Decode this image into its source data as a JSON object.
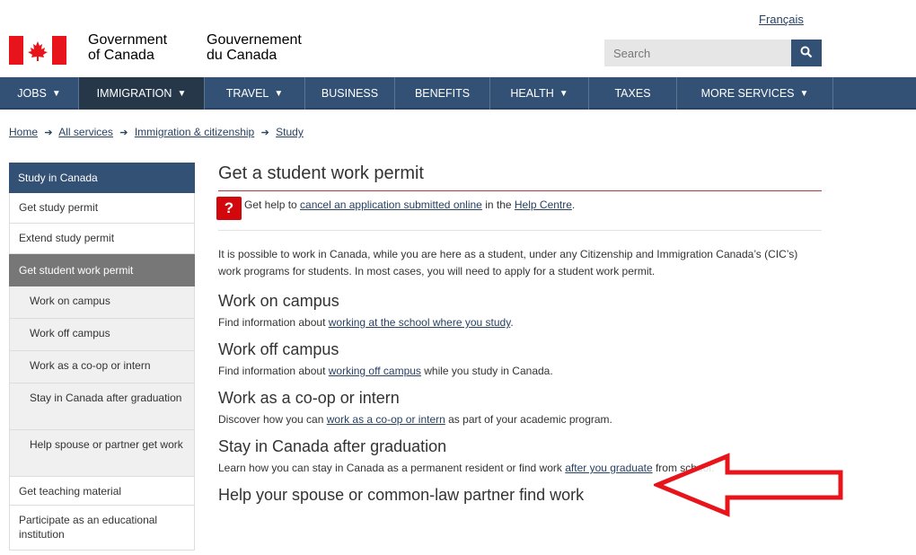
{
  "header": {
    "language_link": "Français",
    "fip_en_line1": "Government",
    "fip_en_line2": "of Canada",
    "fip_fr_line1": "Gouvernement",
    "fip_fr_line2": "du Canada",
    "search_placeholder": "Search",
    "flag_icon": "canada-flag-icon",
    "search_icon": "magnifier-icon"
  },
  "menu": [
    {
      "label": "JOBS",
      "caret": true
    },
    {
      "label": "IMMIGRATION",
      "caret": true
    },
    {
      "label": "TRAVEL",
      "caret": true
    },
    {
      "label": "BUSINESS",
      "caret": false
    },
    {
      "label": "BENEFITS",
      "caret": false
    },
    {
      "label": "HEALTH",
      "caret": true
    },
    {
      "label": "TAXES",
      "caret": false
    },
    {
      "label": "MORE SERVICES",
      "caret": true
    }
  ],
  "breadcrumb": [
    "Home",
    "All services",
    "Immigration & citizenship",
    "Study"
  ],
  "sidenav": [
    "Study in Canada",
    "Get study permit",
    "Extend study permit",
    "Get student work permit",
    "Work on campus",
    "Work off campus",
    "Work as a co-op or intern",
    "Stay in Canada after graduation",
    "Help spouse or partner get work",
    "Get teaching material",
    "Participate as an educational institution"
  ],
  "main": {
    "title": "Get a student work permit",
    "help_icon": "?",
    "help_prefix": "Get help to ",
    "help_link1": "cancel an application submitted online",
    "help_middle": " in the ",
    "help_link2": "Help Centre",
    "help_suffix": ".",
    "intro": "It is possible to work in Canada, while you are here as a student, under any Citizenship and Immigration Canada’s (CIC’s) work programs for students. In most cases, you will need to apply for a student work permit.",
    "sections": [
      {
        "heading": "Work on campus",
        "before": "Find information about ",
        "link": "working at the school where you study",
        "after": "."
      },
      {
        "heading": "Work off campus",
        "before": "Find information about ",
        "link": "working off campus",
        "after": " while you study in Canada."
      },
      {
        "heading": "Work as a co-op or intern",
        "before": "Discover how you can ",
        "link": "work as a co-op or intern",
        "after": " as part of your academic program."
      },
      {
        "heading": "Stay in Canada after graduation",
        "before": "Learn how you can stay in Canada as a permanent resident or find work ",
        "link": "after you graduate",
        "after": " from school."
      },
      {
        "heading": "Help your spouse or common-law partner find work",
        "before": "",
        "link": "",
        "after": ""
      }
    ]
  },
  "annotation": {
    "arrow_color": "#e8141c",
    "arrow_icon": "left-arrow-icon"
  }
}
